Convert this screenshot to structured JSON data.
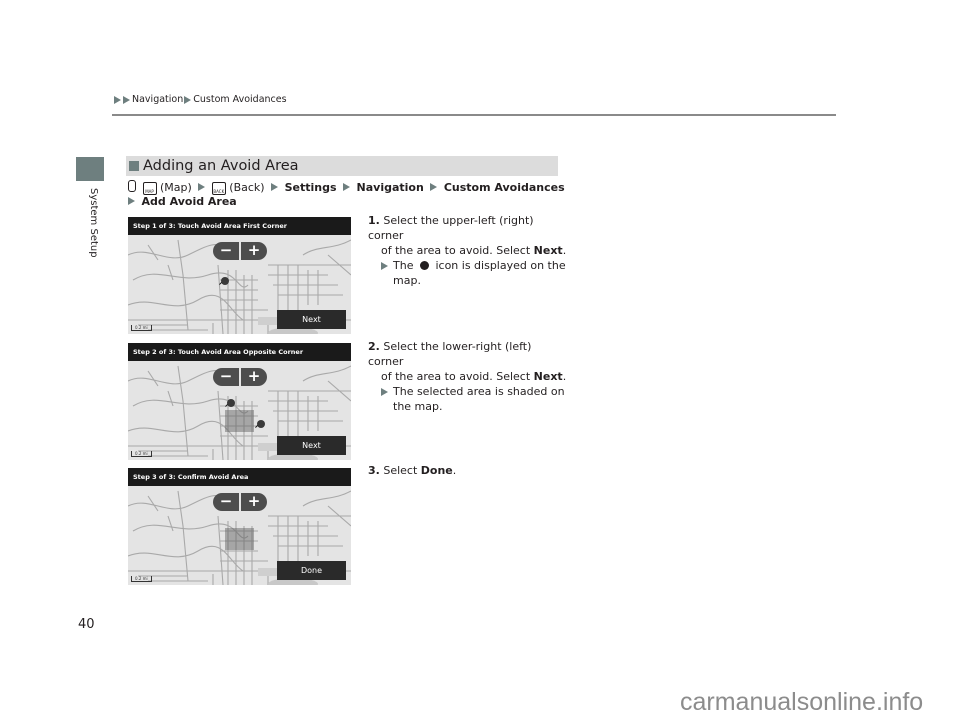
{
  "breadcrumb": {
    "items": [
      "Navigation",
      "Custom Avoidances"
    ]
  },
  "side_tab": {
    "label": "System Setup"
  },
  "section": {
    "title": "Adding an Avoid Area"
  },
  "path": {
    "map_icon_text": "MAP",
    "map_label": "(Map)",
    "back_icon_text": "BACK",
    "back_label": "(Back)",
    "steps": [
      "Settings",
      "Navigation",
      "Custom Avoidances",
      "Add Avoid Area"
    ]
  },
  "screens": [
    {
      "title": "Step 1 of 3: Touch Avoid Area First Corner",
      "zoom_out": "−",
      "zoom_in": "+",
      "action": "Next",
      "scale": "0.2 mi"
    },
    {
      "title": "Step 2 of 3: Touch Avoid Area Opposite Corner",
      "zoom_out": "−",
      "zoom_in": "+",
      "action": "Next",
      "scale": "0.2 mi"
    },
    {
      "title": "Step 3 of 3: Confirm Avoid Area",
      "zoom_out": "−",
      "zoom_in": "+",
      "action": "Done",
      "scale": "0.2 mi"
    }
  ],
  "steps": [
    {
      "num": "1.",
      "line1": "Select the upper-left (right) corner",
      "line2a": "of the area to avoid. Select ",
      "line2b": "Next",
      "line2c": ".",
      "sub_a": "The ",
      "sub_b": " icon is displayed on the",
      "sub_c": "map."
    },
    {
      "num": "2.",
      "line1": "Select the lower-right (left) corner",
      "line2a": "of the area to avoid. Select ",
      "line2b": "Next",
      "line2c": ".",
      "sub_a": "The selected area is shaded on",
      "sub_c": "the map."
    },
    {
      "num": "3.",
      "line1a": "Select ",
      "line1b": "Done",
      "line1c": "."
    }
  ],
  "page_number": "40",
  "watermark": "carmanualsonline.info"
}
